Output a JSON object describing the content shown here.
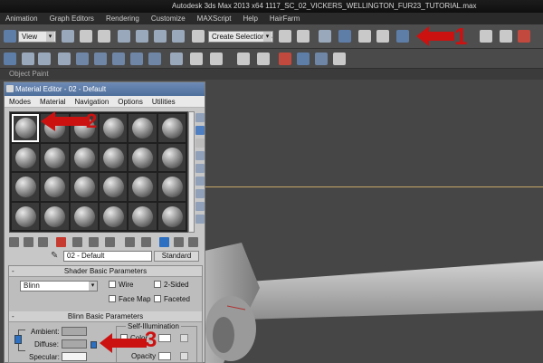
{
  "window": {
    "title": "Autodesk 3ds Max  2013 x64     1117_SC_02_VICKERS_WELLINGTON_FUR23_TUTORIAL.max"
  },
  "main_menu": [
    "Animation",
    "Graph Editors",
    "Rendering",
    "Customize",
    "MAXScript",
    "Help",
    "HairFarm"
  ],
  "toolbar": {
    "reference_coord": "View",
    "selection_set": "Create Selection Se"
  },
  "ribbon": {
    "label": "Object Paint"
  },
  "material_editor": {
    "title": "Material Editor - 02 - Default",
    "menu": [
      "Modes",
      "Material",
      "Navigation",
      "Options",
      "Utilities"
    ],
    "material_name": "02 - Default",
    "material_type": "Standard",
    "shader_rollout": {
      "title": "Shader Basic Parameters",
      "shader": "Blinn",
      "options": [
        "Wire",
        "2-Sided",
        "Face Map",
        "Faceted"
      ]
    },
    "blinn_rollout": {
      "title": "Blinn Basic Parameters",
      "self_illumination_title": "Self-Illumination",
      "color_label": "Color",
      "opacity_label": "Opacity",
      "ambient_label": "Ambient:",
      "diffuse_label": "Diffuse:",
      "specular_label": "Specular:"
    }
  },
  "callouts": [
    "1",
    "2",
    "3"
  ],
  "colors": {
    "accent_blue": "#2d6fc0",
    "callout_red": "#cc1111",
    "viewport_bg": "#464646"
  }
}
